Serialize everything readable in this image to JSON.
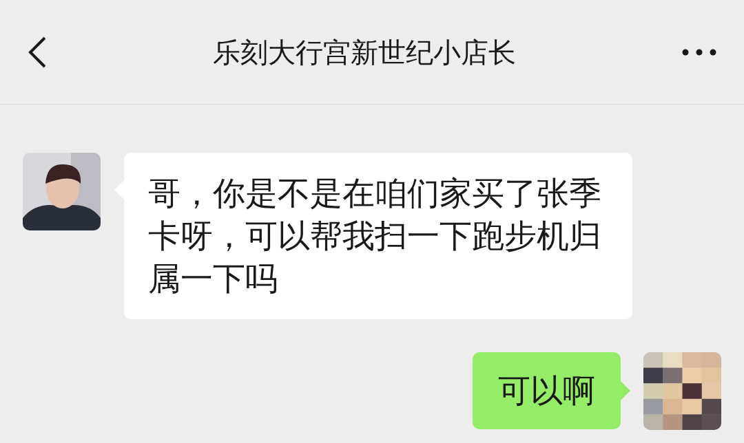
{
  "header": {
    "title": "乐刻大行宫新世纪小店长"
  },
  "messages": [
    {
      "kind": "received",
      "text": "哥，你是不是在咱们家买了张季卡呀，可以帮我扫一下跑步机归属一下吗"
    },
    {
      "kind": "sent",
      "text": "可以啊"
    }
  ]
}
